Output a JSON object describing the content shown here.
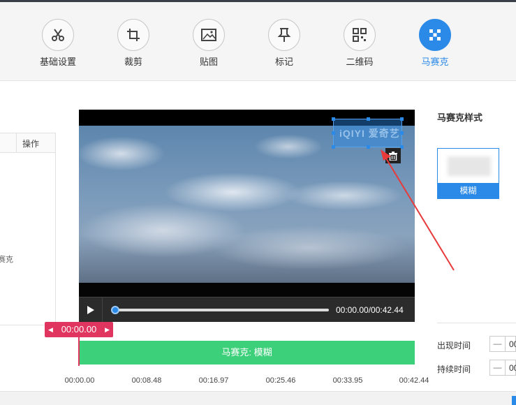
{
  "toolbar": {
    "tools": [
      {
        "label": "基础设置",
        "icon": "scissors-icon"
      },
      {
        "label": "裁剪",
        "icon": "crop-icon"
      },
      {
        "label": "贴图",
        "icon": "image-icon"
      },
      {
        "label": "标记",
        "icon": "pin-icon"
      },
      {
        "label": "二维码",
        "icon": "qrcode-icon"
      },
      {
        "label": "马赛克",
        "icon": "mosaic-icon",
        "active": true
      }
    ]
  },
  "left_panel": {
    "column_header": "操作",
    "row_text": "赛克"
  },
  "player": {
    "timecode": "00:00.00/00:42.44",
    "progress": 0,
    "watermark_text": "iQIYI 爱奇艺"
  },
  "timeline": {
    "current_time": "00:00.00",
    "clip_label": "马赛克: 模糊",
    "ticks": [
      "00:00.00",
      "00:08.48",
      "00:16.97",
      "00:25.46",
      "00:33.95",
      "00:42.44"
    ]
  },
  "right_panel": {
    "title": "马赛克样式",
    "style_label": "模糊",
    "fields": [
      {
        "label": "出现时间",
        "value": "00"
      },
      {
        "label": "持续时间",
        "value": "00"
      }
    ]
  },
  "colors": {
    "accent": "#2b8ae8",
    "timeline_green": "#3dd07a",
    "playhead_red": "#e0355f"
  }
}
